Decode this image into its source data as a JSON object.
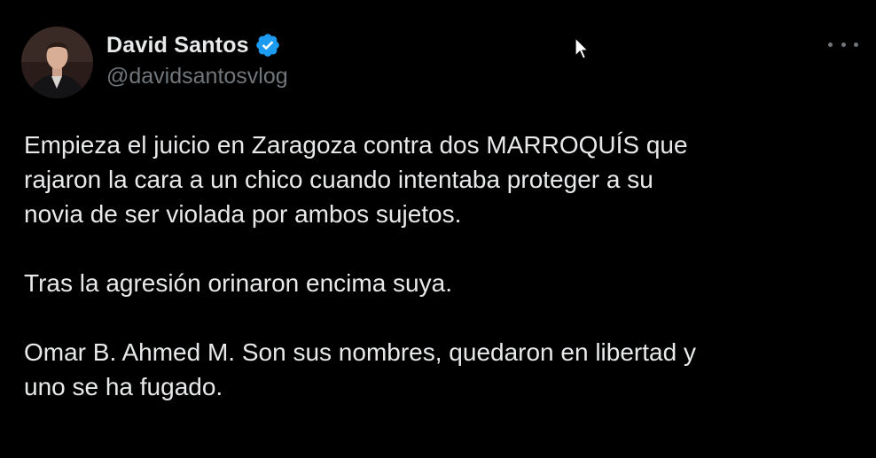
{
  "author": {
    "display_name": "David Santos",
    "handle": "@davidsantosvlog",
    "verified": true,
    "verified_color": "#1d9bf0"
  },
  "tweet": {
    "paragraphs": [
      [
        "Empieza el juicio en Zaragoza contra dos MARROQUÍS que",
        "rajaron la cara a un chico cuando intentaba proteger a su",
        "novia de ser violada por ambos sujetos."
      ],
      [
        "Tras la agresión orinaron encima suya."
      ],
      [
        "Omar B. Ahmed M. Son sus nombres, quedaron en libertad y",
        "uno se ha fugado."
      ]
    ]
  },
  "icons": {
    "more": "more-horizontal-icon",
    "verified": "verified-badge-icon",
    "cursor": "mouse-pointer-icon"
  },
  "colors": {
    "background": "#000000",
    "text_primary": "#e7e9ea",
    "text_secondary": "#71767b"
  }
}
